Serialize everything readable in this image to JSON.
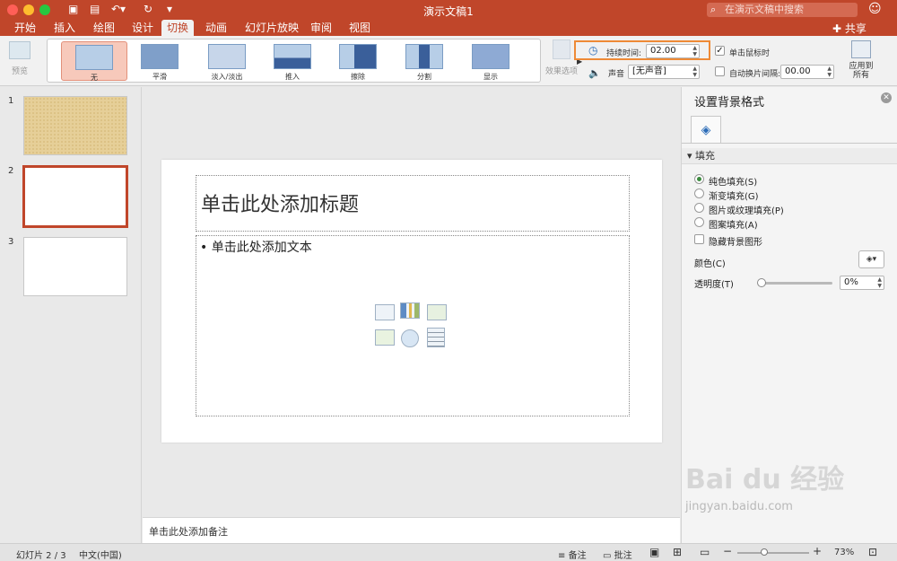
{
  "window": {
    "title": "演示文稿1",
    "search_placeholder": "在演示文稿中搜索"
  },
  "colors": {
    "accent": "#c0462a",
    "highlight": "#ee8a36"
  },
  "tabs": [
    {
      "label": "开始"
    },
    {
      "label": "插入"
    },
    {
      "label": "绘图"
    },
    {
      "label": "设计"
    },
    {
      "label": "切换",
      "active": true
    },
    {
      "label": "动画"
    },
    {
      "label": "幻灯片放映"
    },
    {
      "label": "审阅"
    },
    {
      "label": "视图"
    }
  ],
  "share_label": "共享",
  "ribbon": {
    "preview_label": "预览",
    "transitions": [
      {
        "label": "无",
        "selected": true
      },
      {
        "label": "平滑"
      },
      {
        "label": "淡入/淡出"
      },
      {
        "label": "推入"
      },
      {
        "label": "擦除"
      },
      {
        "label": "分割"
      },
      {
        "label": "显示"
      }
    ],
    "effect_options_label": "效果选项",
    "duration_label": "持续时间:",
    "duration_value": "02.00",
    "sound_label": "声音",
    "sound_value": "[无声音]",
    "on_click_label": "单击鼠标时",
    "on_click_checked": true,
    "after_label": "自动换片间隔:",
    "after_value": "00.00",
    "apply_all_label": "应用到\n所有"
  },
  "slides": [
    {
      "number": "1"
    },
    {
      "number": "2",
      "selected": true
    },
    {
      "number": "3"
    }
  ],
  "slide": {
    "title_placeholder": "单击此处添加标题",
    "body_placeholder": "• 单击此处添加文本"
  },
  "notes_placeholder": "单击此处添加备注",
  "format_pane": {
    "title": "设置背景格式",
    "section": "填充",
    "options": [
      "纯色填充(S)",
      "渐变填充(G)",
      "图片或纹理填充(P)",
      "图案填充(A)"
    ],
    "selected_option": 0,
    "hide_bg_label": "隐藏背景图形",
    "color_label": "颜色(C)",
    "transparency_label": "透明度(T)",
    "transparency_value": "0%"
  },
  "statusbar": {
    "slide_counter": "幻灯片 2 / 3",
    "language": "中文(中国)",
    "notes_label": "备注",
    "comments_label": "批注",
    "zoom": "73%"
  },
  "watermark": {
    "brand": "Bai du 经验",
    "url": "jingyan.baidu.com"
  }
}
